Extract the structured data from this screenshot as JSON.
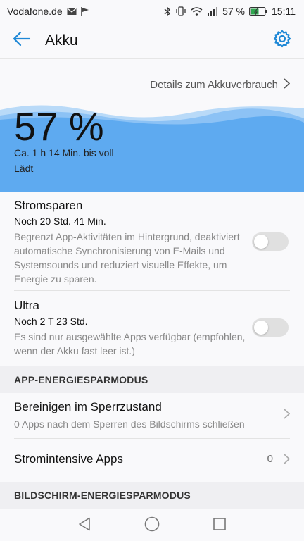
{
  "status_bar": {
    "carrier": "Vodafone.de",
    "battery_percent": "57 %",
    "time": "15:11",
    "icons": [
      "email-icon",
      "flag-icon",
      "bluetooth-icon",
      "vibrate-icon",
      "wifi-icon",
      "signal-icon",
      "battery-charging-icon"
    ]
  },
  "app_bar": {
    "title": "Akku",
    "back_icon": "back-arrow-icon",
    "settings_icon": "gear-icon",
    "accent_color": "#1e88d6"
  },
  "details_link": {
    "label": "Details zum Akkuverbrauch"
  },
  "battery": {
    "percent_label": "57 %",
    "level": 0.57,
    "time_to_full": "Ca. 1 h 14 Min. bis voll",
    "state": "Lädt",
    "wave_color": "#5eaaf0"
  },
  "power_saving": {
    "title": "Stromsparen",
    "remaining": "Noch 20 Std. 41 Min.",
    "description": "Begrenzt App-Aktivitäten im Hintergrund, deaktiviert automatische Synchronisierung von E-Mails und Systemsounds und reduziert visuelle Effekte, um Energie zu sparen.",
    "enabled": false
  },
  "ultra": {
    "title": "Ultra",
    "remaining": "Noch 2 T 23 Std.",
    "description": "Es sind nur ausgewählte Apps verfügbar (empfohlen, wenn der Akku fast leer ist.)",
    "enabled": false
  },
  "app_section": {
    "header": "APP-ENERGIESPARMODUS",
    "items": [
      {
        "title": "Bereinigen im Sperrzustand",
        "subtitle": "0 Apps nach dem Sperren des Bildschirms schließen"
      },
      {
        "title": "Stromintensive Apps",
        "value": "0"
      }
    ]
  },
  "screen_section": {
    "header": "BILDSCHIRM-ENERGIESPARMODUS"
  },
  "nav_bar": {
    "icons": [
      "back-triangle-icon",
      "home-circle-icon",
      "recents-square-icon"
    ]
  }
}
